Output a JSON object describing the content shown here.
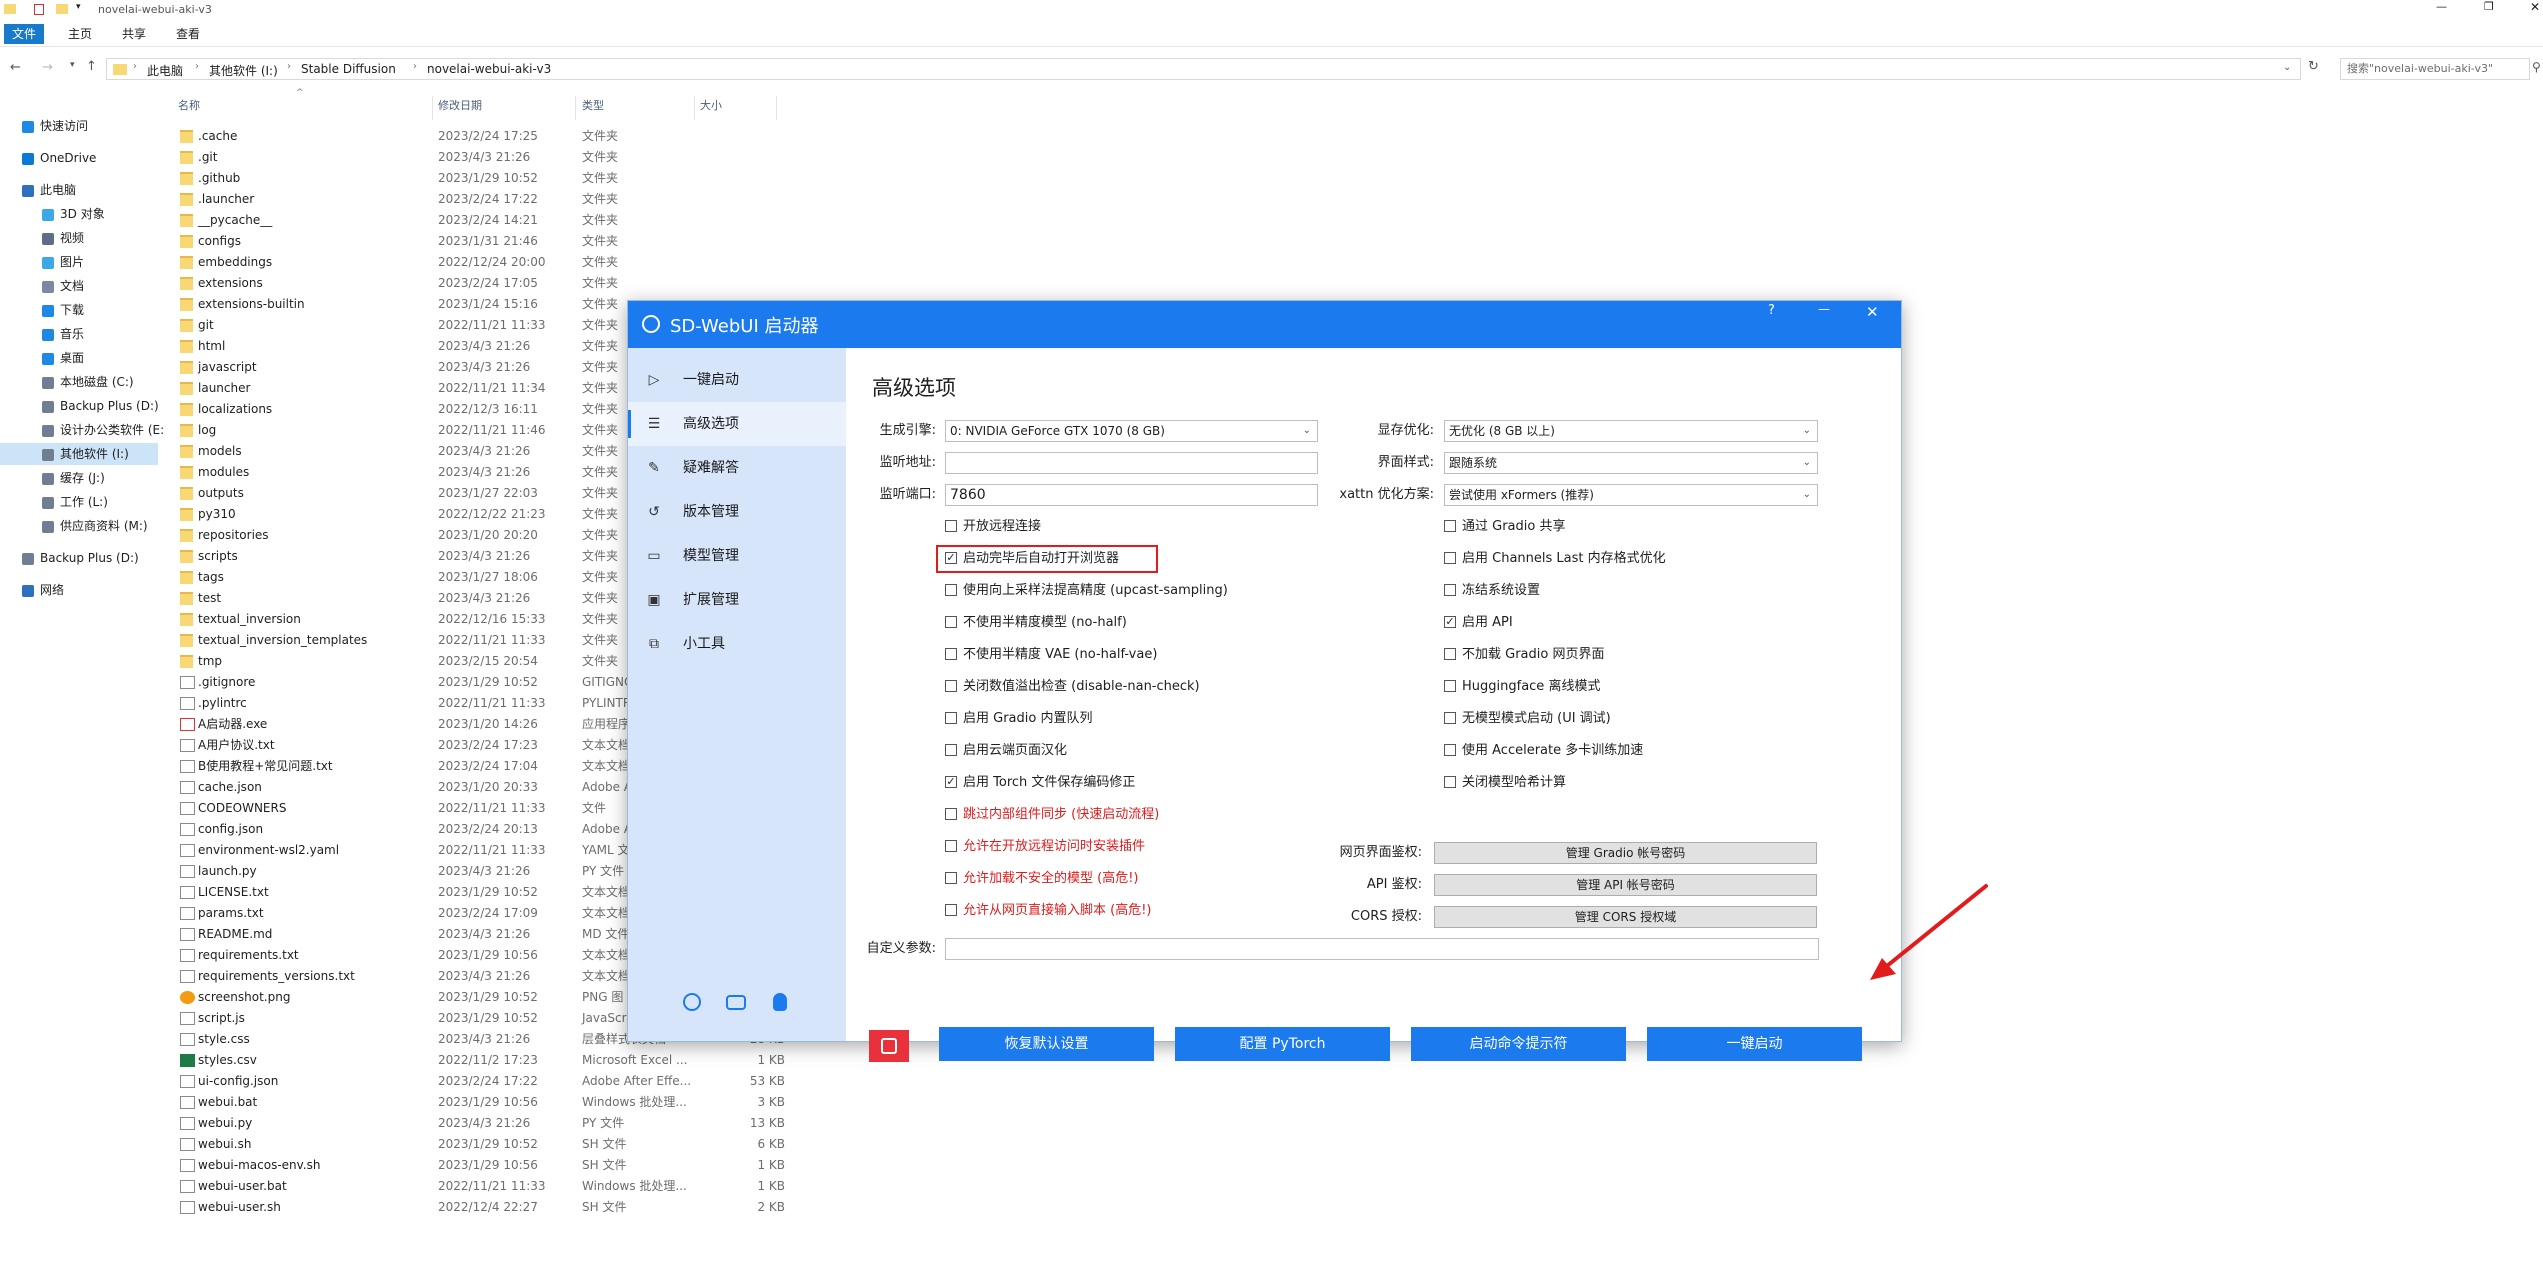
{
  "window": {
    "title": "novelai-webui-aki-v3"
  },
  "ribbon": {
    "tabs": [
      "文件",
      "主页",
      "共享",
      "查看"
    ]
  },
  "address": {
    "crumbs": [
      "此电脑",
      "其他软件 (I:)",
      "Stable Diffusion",
      "novelai-webui-aki-v3"
    ],
    "search_placeholder": "搜索\"novelai-webui-aki-v3\""
  },
  "nav": {
    "items": [
      {
        "label": "快速访问",
        "color": "#1e88e5"
      },
      {
        "label": "OneDrive",
        "color": "#0a7ad6"
      },
      {
        "label": "此电脑",
        "color": "#2f6fbf"
      },
      {
        "label": "3D 对象",
        "color": "#3ea7e8"
      },
      {
        "label": "视频",
        "color": "#5c6f84"
      },
      {
        "label": "图片",
        "color": "#3ea7e8"
      },
      {
        "label": "文档",
        "color": "#7a8a9e"
      },
      {
        "label": "下载",
        "color": "#1e88e5"
      },
      {
        "label": "音乐",
        "color": "#1e88e5"
      },
      {
        "label": "桌面",
        "color": "#1e88e5"
      },
      {
        "label": "本地磁盘 (C:)",
        "color": "#6f7f91"
      },
      {
        "label": "Backup Plus (D:)",
        "color": "#6f7f91"
      },
      {
        "label": "设计办公类软件 (E:",
        "color": "#6f7f91"
      },
      {
        "label": "其他软件 (I:)",
        "color": "#6f7f91"
      },
      {
        "label": "缓存 (J:)",
        "color": "#6f7f91"
      },
      {
        "label": "工作 (L:)",
        "color": "#6f7f91"
      },
      {
        "label": "供应商资料 (M:)",
        "color": "#6f7f91"
      },
      {
        "label": "Backup Plus (D:)",
        "color": "#6f7f91"
      },
      {
        "label": "网络",
        "color": "#2f6fbf"
      }
    ]
  },
  "columns": {
    "name": "名称",
    "date": "修改日期",
    "type": "类型",
    "size": "大小"
  },
  "files": [
    {
      "name": ".cache",
      "date": "2023/2/24 17:25",
      "type": "文件夹",
      "size": "",
      "kind": "folder"
    },
    {
      "name": ".git",
      "date": "2023/4/3 21:26",
      "type": "文件夹",
      "size": "",
      "kind": "folder"
    },
    {
      "name": ".github",
      "date": "2023/1/29 10:52",
      "type": "文件夹",
      "size": "",
      "kind": "folder"
    },
    {
      "name": ".launcher",
      "date": "2023/2/24 17:22",
      "type": "文件夹",
      "size": "",
      "kind": "folder"
    },
    {
      "name": "__pycache__",
      "date": "2023/2/24 14:21",
      "type": "文件夹",
      "size": "",
      "kind": "folder"
    },
    {
      "name": "configs",
      "date": "2023/1/31 21:46",
      "type": "文件夹",
      "size": "",
      "kind": "folder"
    },
    {
      "name": "embeddings",
      "date": "2022/12/24 20:00",
      "type": "文件夹",
      "size": "",
      "kind": "folder"
    },
    {
      "name": "extensions",
      "date": "2023/2/24 17:05",
      "type": "文件夹",
      "size": "",
      "kind": "folder"
    },
    {
      "name": "extensions-builtin",
      "date": "2023/1/24 15:16",
      "type": "文件夹",
      "size": "",
      "kind": "folder"
    },
    {
      "name": "git",
      "date": "2022/11/21 11:33",
      "type": "文件夹",
      "size": "",
      "kind": "folder"
    },
    {
      "name": "html",
      "date": "2023/4/3 21:26",
      "type": "文件夹",
      "size": "",
      "kind": "folder"
    },
    {
      "name": "javascript",
      "date": "2023/4/3 21:26",
      "type": "文件夹",
      "size": "",
      "kind": "folder"
    },
    {
      "name": "launcher",
      "date": "2022/11/21 11:34",
      "type": "文件夹",
      "size": "",
      "kind": "folder"
    },
    {
      "name": "localizations",
      "date": "2022/12/3 16:11",
      "type": "文件夹",
      "size": "",
      "kind": "folder"
    },
    {
      "name": "log",
      "date": "2022/11/21 11:46",
      "type": "文件夹",
      "size": "",
      "kind": "folder"
    },
    {
      "name": "models",
      "date": "2023/4/3 21:26",
      "type": "文件夹",
      "size": "",
      "kind": "folder"
    },
    {
      "name": "modules",
      "date": "2023/4/3 21:26",
      "type": "文件夹",
      "size": "",
      "kind": "folder"
    },
    {
      "name": "outputs",
      "date": "2023/1/27 22:03",
      "type": "文件夹",
      "size": "",
      "kind": "folder"
    },
    {
      "name": "py310",
      "date": "2022/12/22 21:23",
      "type": "文件夹",
      "size": "",
      "kind": "folder"
    },
    {
      "name": "repositories",
      "date": "2023/1/20 20:20",
      "type": "文件夹",
      "size": "",
      "kind": "folder"
    },
    {
      "name": "scripts",
      "date": "2023/4/3 21:26",
      "type": "文件夹",
      "size": "",
      "kind": "folder"
    },
    {
      "name": "tags",
      "date": "2023/1/27 18:06",
      "type": "文件夹",
      "size": "",
      "kind": "folder"
    },
    {
      "name": "test",
      "date": "2023/4/3 21:26",
      "type": "文件夹",
      "size": "",
      "kind": "folder"
    },
    {
      "name": "textual_inversion",
      "date": "2022/12/16 15:33",
      "type": "文件夹",
      "size": "",
      "kind": "folder"
    },
    {
      "name": "textual_inversion_templates",
      "date": "2022/11/21 11:33",
      "type": "文件夹",
      "size": "",
      "kind": "folder"
    },
    {
      "name": "tmp",
      "date": "2023/2/15 20:54",
      "type": "文件夹",
      "size": "",
      "kind": "folder"
    },
    {
      "name": ".gitignore",
      "date": "2023/1/29 10:52",
      "type": "GITIGNO",
      "size": "",
      "kind": "file"
    },
    {
      "name": ".pylintrc",
      "date": "2022/11/21 11:33",
      "type": "PYLINTR",
      "size": "",
      "kind": "file"
    },
    {
      "name": "A启动器.exe",
      "date": "2023/1/20 14:26",
      "type": "应用程序",
      "size": "",
      "kind": "exe"
    },
    {
      "name": "A用户协议.txt",
      "date": "2023/2/24 17:23",
      "type": "文本文档",
      "size": "",
      "kind": "file"
    },
    {
      "name": "B使用教程+常见问题.txt",
      "date": "2023/2/24 17:04",
      "type": "文本文档",
      "size": "",
      "kind": "file"
    },
    {
      "name": "cache.json",
      "date": "2023/1/20 20:33",
      "type": "Adobe A",
      "size": "",
      "kind": "file"
    },
    {
      "name": "CODEOWNERS",
      "date": "2022/11/21 11:33",
      "type": "文件",
      "size": "",
      "kind": "file"
    },
    {
      "name": "config.json",
      "date": "2023/2/24 20:13",
      "type": "Adobe A",
      "size": "",
      "kind": "file"
    },
    {
      "name": "environment-wsl2.yaml",
      "date": "2022/11/21 11:33",
      "type": "YAML 文",
      "size": "",
      "kind": "file"
    },
    {
      "name": "launch.py",
      "date": "2023/4/3 21:26",
      "type": "PY 文件",
      "size": "",
      "kind": "file"
    },
    {
      "name": "LICENSE.txt",
      "date": "2023/1/29 10:52",
      "type": "文本文档",
      "size": "",
      "kind": "file"
    },
    {
      "name": "params.txt",
      "date": "2023/2/24 17:09",
      "type": "文本文档",
      "size": "",
      "kind": "file"
    },
    {
      "name": "README.md",
      "date": "2023/4/3 21:26",
      "type": "MD 文件",
      "size": "",
      "kind": "file"
    },
    {
      "name": "requirements.txt",
      "date": "2023/1/29 10:56",
      "type": "文本文档",
      "size": "",
      "kind": "file"
    },
    {
      "name": "requirements_versions.txt",
      "date": "2023/4/3 21:26",
      "type": "文本文档",
      "size": "",
      "kind": "file"
    },
    {
      "name": "screenshot.png",
      "date": "2023/1/29 10:52",
      "type": "PNG 图",
      "size": "",
      "kind": "img"
    },
    {
      "name": "script.js",
      "date": "2023/1/29 10:52",
      "type": "JavaScr",
      "size": "",
      "kind": "file"
    },
    {
      "name": "style.css",
      "date": "2023/4/3 21:26",
      "type": "层叠样式表文档",
      "size": "28 KB",
      "kind": "file"
    },
    {
      "name": "styles.csv",
      "date": "2022/11/2 17:23",
      "type": "Microsoft Excel ...",
      "size": "1 KB",
      "kind": "excel"
    },
    {
      "name": "ui-config.json",
      "date": "2023/2/24 17:22",
      "type": "Adobe After Effe...",
      "size": "53 KB",
      "kind": "file"
    },
    {
      "name": "webui.bat",
      "date": "2023/1/29 10:56",
      "type": "Windows 批处理...",
      "size": "3 KB",
      "kind": "file"
    },
    {
      "name": "webui.py",
      "date": "2023/4/3 21:26",
      "type": "PY 文件",
      "size": "13 KB",
      "kind": "file"
    },
    {
      "name": "webui.sh",
      "date": "2023/1/29 10:52",
      "type": "SH 文件",
      "size": "6 KB",
      "kind": "file"
    },
    {
      "name": "webui-macos-env.sh",
      "date": "2023/1/29 10:56",
      "type": "SH 文件",
      "size": "1 KB",
      "kind": "file"
    },
    {
      "name": "webui-user.bat",
      "date": "2022/11/21 11:33",
      "type": "Windows 批处理...",
      "size": "1 KB",
      "kind": "file"
    },
    {
      "name": "webui-user.sh",
      "date": "2022/12/4 22:27",
      "type": "SH 文件",
      "size": "2 KB",
      "kind": "file"
    }
  ],
  "dialog": {
    "title": "SD-WebUI 启动器",
    "help": "?",
    "minimize": "—",
    "close": "✕",
    "sidebar": [
      {
        "label": "一键启动",
        "icon": "▷"
      },
      {
        "label": "高级选项",
        "icon": "☰"
      },
      {
        "label": "疑难解答",
        "icon": "✎"
      },
      {
        "label": "版本管理",
        "icon": "↺"
      },
      {
        "label": "模型管理",
        "icon": "▭"
      },
      {
        "label": "扩展管理",
        "icon": "▣"
      },
      {
        "label": "小工具",
        "icon": "⧉"
      }
    ],
    "footer_icons": [
      "globe-icon",
      "bilibili-icon",
      "qq-icon"
    ],
    "heading": "高级选项",
    "fields": {
      "engine_label": "生成引擎:",
      "engine_value": "0: NVIDIA GeForce GTX 1070 (8 GB)",
      "listen_label": "监听地址:",
      "listen_value": "",
      "port_label": "监听端口:",
      "port_value": "7860",
      "vram_label": "显存优化:",
      "vram_value": "无优化 (8 GB 以上)",
      "theme_label": "界面样式:",
      "theme_value": "跟随系统",
      "xattn_label": "xattn 优化方案:",
      "xattn_value": "尝试使用 xFormers (推荐)",
      "custom_label": "自定义参数:",
      "custom_value": ""
    },
    "left_checks": [
      {
        "label": "开放远程连接",
        "checked": false,
        "red": false
      },
      {
        "label": "启动完毕后自动打开浏览器",
        "checked": true,
        "red": false
      },
      {
        "label": "使用向上采样法提高精度 (upcast-sampling)",
        "checked": false,
        "red": false
      },
      {
        "label": "不使用半精度模型 (no-half)",
        "checked": false,
        "red": false
      },
      {
        "label": "不使用半精度 VAE (no-half-vae)",
        "checked": false,
        "red": false
      },
      {
        "label": "关闭数值溢出检查 (disable-nan-check)",
        "checked": false,
        "red": false
      },
      {
        "label": "启用 Gradio 内置队列",
        "checked": false,
        "red": false
      },
      {
        "label": "启用云端页面汉化",
        "checked": false,
        "red": false
      },
      {
        "label": "启用 Torch 文件保存编码修正",
        "checked": true,
        "red": false
      },
      {
        "label": "跳过内部组件同步 (快速启动流程)",
        "checked": false,
        "red": true
      },
      {
        "label": "允许在开放远程访问时安装插件",
        "checked": false,
        "red": true
      },
      {
        "label": "允许加载不安全的模型 (高危!)",
        "checked": false,
        "red": true
      },
      {
        "label": "允许从网页直接输入脚本 (高危!)",
        "checked": false,
        "red": true
      }
    ],
    "right_checks": [
      {
        "label": "通过 Gradio 共享",
        "checked": false
      },
      {
        "label": "启用 Channels Last 内存格式优化",
        "checked": false
      },
      {
        "label": "冻结系统设置",
        "checked": false
      },
      {
        "label": "启用 API",
        "checked": true
      },
      {
        "label": "不加载 Gradio 网页界面",
        "checked": false
      },
      {
        "label": "Huggingface 离线模式",
        "checked": false
      },
      {
        "label": "无模型模式启动 (UI 调试)",
        "checked": false
      },
      {
        "label": "使用 Accelerate 多卡训练加速",
        "checked": false
      },
      {
        "label": "关闭模型哈希计算",
        "checked": false
      }
    ],
    "auth": {
      "web_label": "网页界面鉴权:",
      "web_button": "管理 Gradio 帐号密码",
      "api_label": "API 鉴权:",
      "api_button": "管理 API 帐号密码",
      "cors_label": "CORS 授权:",
      "cors_button": "管理 CORS 授权域"
    },
    "buttons": {
      "reset": "恢复默认设置",
      "pytorch": "配置 PyTorch",
      "cmd": "启动命令提示符",
      "launch": "一键启动"
    },
    "colors": {
      "accent": "#1a7aee",
      "sidebar": "#d7e5fb",
      "highlight": "#e21b1b",
      "danger_button": "#e8313a"
    }
  }
}
